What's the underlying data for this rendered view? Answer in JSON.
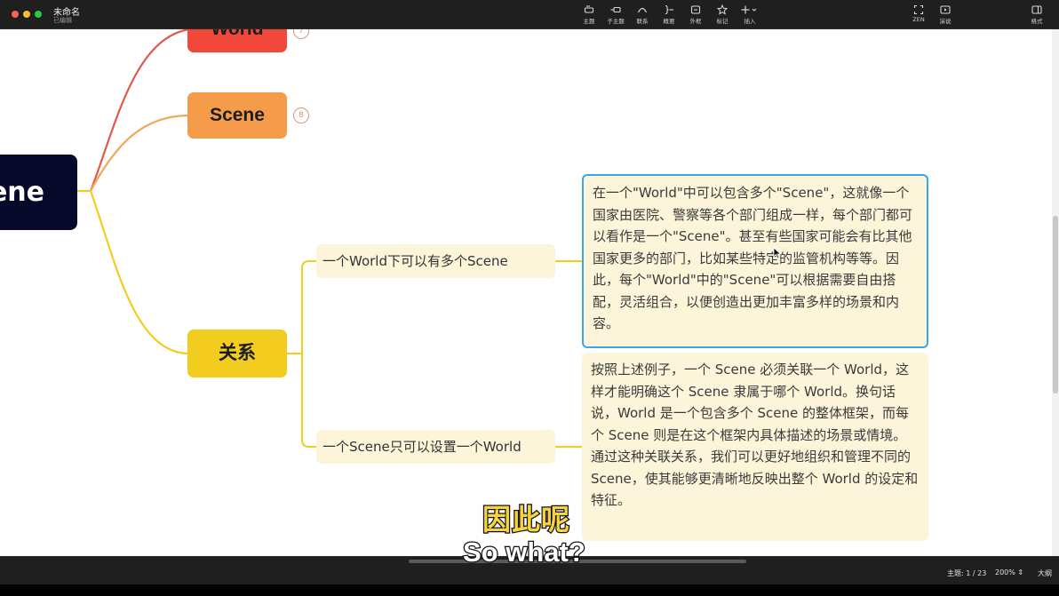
{
  "window": {
    "title": "未命名",
    "status": "已编辑"
  },
  "toolbar": {
    "topic": "主题",
    "subtopic": "子主题",
    "relationship": "联系",
    "summary": "概要",
    "boundary": "外框",
    "marker": "标记",
    "insert": "插入",
    "zen": "ZEN",
    "present": "演说",
    "format": "格式"
  },
  "mindmap": {
    "central": "ene",
    "topics": [
      {
        "label": "World",
        "badge": "7"
      },
      {
        "label": "Scene",
        "badge": "8"
      },
      {
        "label": "关系"
      }
    ],
    "subtopics": [
      "一个World下可以有多个Scene",
      "一个Scene只可以设置一个World"
    ],
    "notes": [
      "在一个\"World\"中可以包含多个\"Scene\"，这就像一个国家由医院、警察等各个部门组成一样，每个部门都可以看作是一个\"Scene\"。甚至有些国家可能会有比其他国家更多的部门，比如某些特定的监管机构等等。因此，每个\"World\"中的\"Scene\"可以根据需要自由搭配，灵活组合，以便创造出更加丰富多样的场景和内容。",
      "按照上述例子，一个 Scene 必须关联一个 World，这样才能明确这个 Scene 隶属于哪个 World。换句话说，World 是一个包含多个 Scene 的整体框架，而每个 Scene 则是在这个框架内具体描述的场景或情境。通过这种关联关系，我们可以更好地组织和管理不同的 Scene，使其能够更清晰地反映出整个 World 的设定和特征。"
    ]
  },
  "statusbar": {
    "topic_count": "主题: 1 / 23",
    "zoom": "200%",
    "outline": "大纲"
  },
  "subtitles": {
    "cn": "因此呢",
    "en": "So what?"
  },
  "colors": {
    "central": "#07092a",
    "world": "#f2483a",
    "scene": "#f59c4a",
    "relation": "#f2cd1f",
    "note_bg": "#fcf5d9",
    "selection": "#3aa6e8"
  }
}
